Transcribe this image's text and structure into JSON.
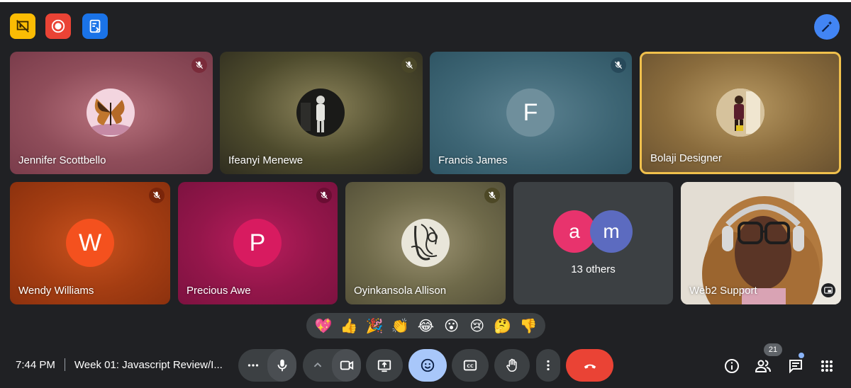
{
  "colors": {
    "background": "#202124",
    "activity_button": "#fbbc04",
    "record_button": "#ea4335",
    "notes_button": "#1a73e8",
    "effects_button": "#4285f4",
    "control_button": "#3c4043",
    "active_control": "#a8c7fa",
    "leave_button": "#ea4335",
    "active_speaker_border": "#f0c04c"
  },
  "top_bar": {
    "left_icons": [
      "activity-icon",
      "record-icon",
      "notes-icon"
    ],
    "right_icon": "visual-effects-icon"
  },
  "participants": [
    {
      "name": "Jennifer Scottbello",
      "avatar_type": "photo",
      "muted": true
    },
    {
      "name": "Ifeanyi Menewe",
      "avatar_type": "photo",
      "muted": true
    },
    {
      "name": "Francis James",
      "avatar_type": "letter",
      "letter": "F",
      "avatar_color": "#6f8f9c",
      "muted": true
    },
    {
      "name": "Bolaji Designer",
      "avatar_type": "photo",
      "muted": false,
      "speaking": true
    },
    {
      "name": "Wendy Williams",
      "avatar_type": "letter",
      "letter": "W",
      "avatar_color": "#f4511e",
      "muted": true
    },
    {
      "name": "Precious Awe",
      "avatar_type": "letter",
      "letter": "P",
      "avatar_color": "#d81b60",
      "muted": true
    },
    {
      "name": "Oyinkansola Allison",
      "avatar_type": "photo",
      "muted": true
    },
    {
      "name": "Web2 Support",
      "avatar_type": "video",
      "muted": false
    }
  ],
  "others_tile": {
    "avatars": [
      {
        "letter": "a",
        "color": "#e8336d"
      },
      {
        "letter": "m",
        "color": "#5c6bc0"
      }
    ],
    "label": "13 others"
  },
  "reactions": [
    "💖",
    "👍",
    "🎉",
    "👏",
    "😂",
    "😮",
    "😢",
    "🤔",
    "👎"
  ],
  "bottom_bar": {
    "time": "7:44 PM",
    "meeting_title": "Week 01: Javascript Review/I...",
    "people_count": "21"
  }
}
